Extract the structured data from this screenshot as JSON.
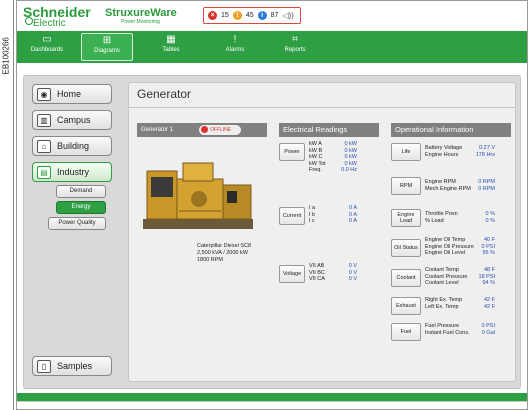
{
  "side_code": "EB100266",
  "brand": {
    "name": "Schneider",
    "name_sub": "Electric",
    "product": "StruxureWare",
    "product_sub": "Power Monitoring"
  },
  "alarms": {
    "critical": "15",
    "warning": "45",
    "info": "87"
  },
  "nav": [
    {
      "label": "Dashboards",
      "icon": "monitor-icon"
    },
    {
      "label": "Diagrams",
      "icon": "diagram-icon"
    },
    {
      "label": "Tables",
      "icon": "table-icon"
    },
    {
      "label": "Alarms",
      "icon": "alarm-icon"
    },
    {
      "label": "Reports",
      "icon": "reports-icon"
    }
  ],
  "active_nav": "Diagrams",
  "left_nav": {
    "home": "Home",
    "campus": "Campus",
    "building": "Building",
    "industry": "Industry",
    "sub": [
      "Demand",
      "Energy",
      "Power Quality"
    ],
    "samples": "Samples"
  },
  "panel": {
    "title": "Generator"
  },
  "generator": {
    "name": "Generator 1",
    "status": "OFFLINE",
    "caption": [
      "Caterpillar Diesel SC8",
      "2,500 kVA / 2000 kW",
      "1800 RPM"
    ]
  },
  "electrical": {
    "title": "Electrical Readings",
    "power": {
      "label": "Power",
      "rows": [
        [
          "kW A",
          "0 kW"
        ],
        [
          "kW B",
          "0 kW"
        ],
        [
          "kW C",
          "0 kW"
        ],
        [
          "kW Tot",
          "0 kW"
        ],
        [
          "Freq.",
          "0.0 Hz"
        ]
      ]
    },
    "current": {
      "label": "Current",
      "rows": [
        [
          "I a",
          "0 A"
        ],
        [
          "I b",
          "0 A"
        ],
        [
          "I c",
          "0 A"
        ]
      ]
    },
    "voltage": {
      "label": "Voltage",
      "rows": [
        [
          "VII AB",
          "0 V"
        ],
        [
          "VII BC",
          "0 V"
        ],
        [
          "VII CA",
          "0 V"
        ]
      ]
    }
  },
  "operational": {
    "title": "Operational Information",
    "groups": [
      {
        "label": "Life",
        "rows": [
          [
            "Battery Voltage",
            "0.27 V"
          ],
          [
            "Engine Hours",
            "178 Hrs"
          ]
        ]
      },
      {
        "label": "RPM",
        "rows": [
          [
            "Engine RPM",
            "0 RPM"
          ],
          [
            "Mech Engine RPM",
            "0 RPM"
          ]
        ]
      },
      {
        "label": "Engine Load",
        "rows": [
          [
            "Throttle Posn",
            "0 %"
          ],
          [
            "% Load",
            "0 %"
          ]
        ]
      },
      {
        "label": "Oil Status",
        "rows": [
          [
            "Engine Oil Temp",
            "40 F"
          ],
          [
            "Engine Oil Pressure",
            "0 PSI"
          ],
          [
            "Engine Oil Level",
            "95 %"
          ]
        ]
      },
      {
        "label": "Coolant",
        "rows": [
          [
            "Coolant Temp",
            "48 F"
          ],
          [
            "Coolant Pressure",
            "18 PSI"
          ],
          [
            "Coolant Level",
            "94 %"
          ]
        ]
      },
      {
        "label": "Exhaust",
        "rows": [
          [
            "Right Ex. Temp",
            "42 F"
          ],
          [
            "Left Ex. Temp",
            "42 F"
          ]
        ]
      },
      {
        "label": "Fuel",
        "rows": [
          [
            "Fuel Pressure",
            "0 PSI"
          ],
          [
            "Instant Fuel Cons.",
            "0 Gal"
          ]
        ]
      }
    ]
  },
  "colors": {
    "green": "#2ea043",
    "panel": "#efefef",
    "header_gray": "#808080",
    "value_blue": "#2a4fb0",
    "alarm_red": "#d8332a"
  }
}
